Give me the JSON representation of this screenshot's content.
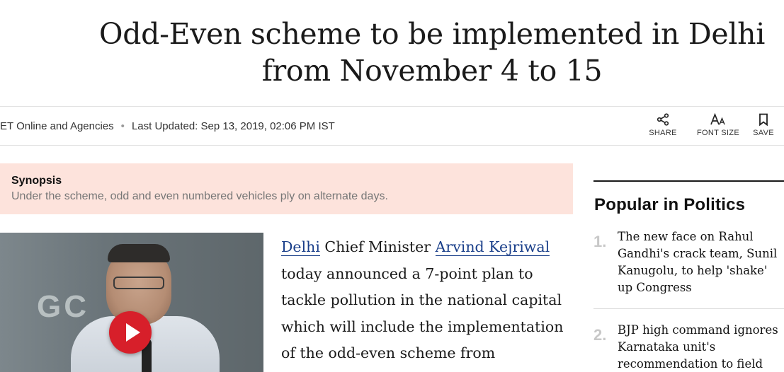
{
  "article": {
    "headline": "Odd-Even scheme to be implemented in Delhi from November 4 to 15",
    "byline": {
      "author": "ET Online and Agencies",
      "separator": "•",
      "updated": "Last Updated: Sep 13, 2019, 02:06 PM IST"
    },
    "tools": {
      "share_label": "SHARE",
      "font_size_label": "FONT SIZE",
      "save_label": "SAVE"
    },
    "synopsis": {
      "label": "Synopsis",
      "text": "Under the scheme, odd and even numbered vehicles ply on alternate days."
    },
    "video": {
      "wall_text": "GC"
    },
    "body": {
      "link1": "Delhi",
      "text1": " Chief Minister ",
      "link2": "Arvind Kejriwal",
      "text2": " today announced a 7-point plan to tackle pollution in the national capital which will include the implementation of the odd-even scheme from"
    }
  },
  "sidebar": {
    "title": "Popular in Politics",
    "items": [
      {
        "number": "1.",
        "title": "The new face on Rahul Gandhi's crack team, Sunil Kanugolu, to help 'shake' up Congress"
      },
      {
        "number": "2.",
        "title": "BJP high command ignores Karnataka unit's recommendation to field"
      }
    ]
  },
  "colors": {
    "synopsis_bg": "#fde3dc",
    "link": "#1a3f8a",
    "play_button": "#d71f2a"
  }
}
